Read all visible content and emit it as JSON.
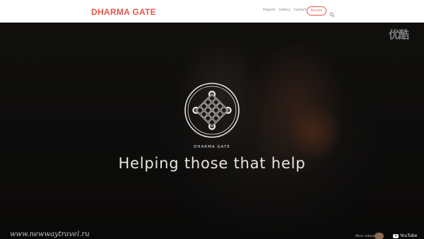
{
  "header": {
    "logo": "DHARMA GATE",
    "nav": [
      "Projects",
      "Gallery",
      "Contact"
    ],
    "donate_label": "Donate",
    "search_icon": "search-icon"
  },
  "hero": {
    "watermark_top": "优酷",
    "emblem_icon": "endless-knot-icon",
    "emblem_label": "DHARMA GATE",
    "headline": "Helping those that help",
    "bottom_watermark": "www.newwaytravel.ru",
    "more_videos": "More videos",
    "youtube_label": "YouTube"
  },
  "colors": {
    "brand": "#e2574c",
    "header_bg": "#ffffff",
    "hero_bg": "#121110",
    "headline": "#e8e6e3"
  }
}
